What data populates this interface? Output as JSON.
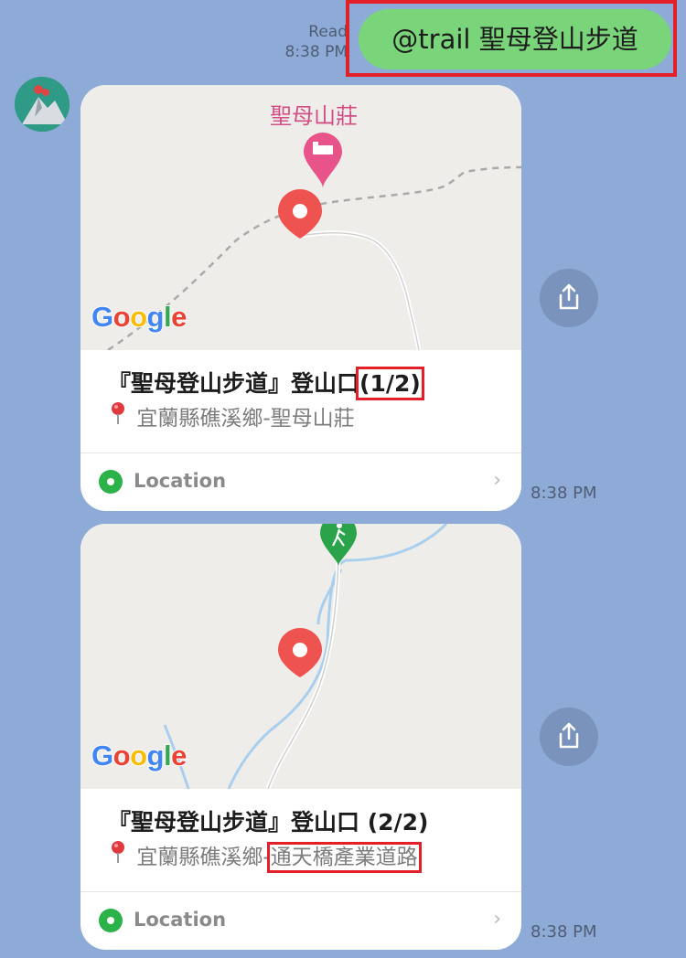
{
  "outgoing": {
    "status": "Read",
    "time": "8:38 PM",
    "text": "@trail 聖母登山步道"
  },
  "cards": [
    {
      "map_place_label": "聖母山莊",
      "title_main": "『聖母登山步道』登山口",
      "title_suffix": "(1/2)",
      "address_prefix": "宜蘭縣礁溪鄉-聖母山莊",
      "address_suffix": "",
      "location_label": "Location",
      "time": "8:38 PM"
    },
    {
      "map_place_label": "",
      "title_main": "『聖母登山步道』登山口 (2/2)",
      "title_suffix": "",
      "address_prefix": "宜蘭縣礁溪鄉-",
      "address_suffix": "通天橋產業道路",
      "location_label": "Location",
      "time": "8:38 PM"
    }
  ],
  "map_brand": "Google",
  "icons": {
    "share": "share-icon",
    "pin": "map-pin-icon",
    "location": "location-icon",
    "chevron": "chevron-right-icon",
    "lodging": "lodging-marker-icon",
    "hiking": "hiking-marker-icon"
  },
  "colors": {
    "background": "#8eabd8",
    "outgoing_bubble": "#7ad57a",
    "highlight": "#e3202a",
    "map_pin": "#ef5350",
    "location_green": "#2bb34a"
  }
}
